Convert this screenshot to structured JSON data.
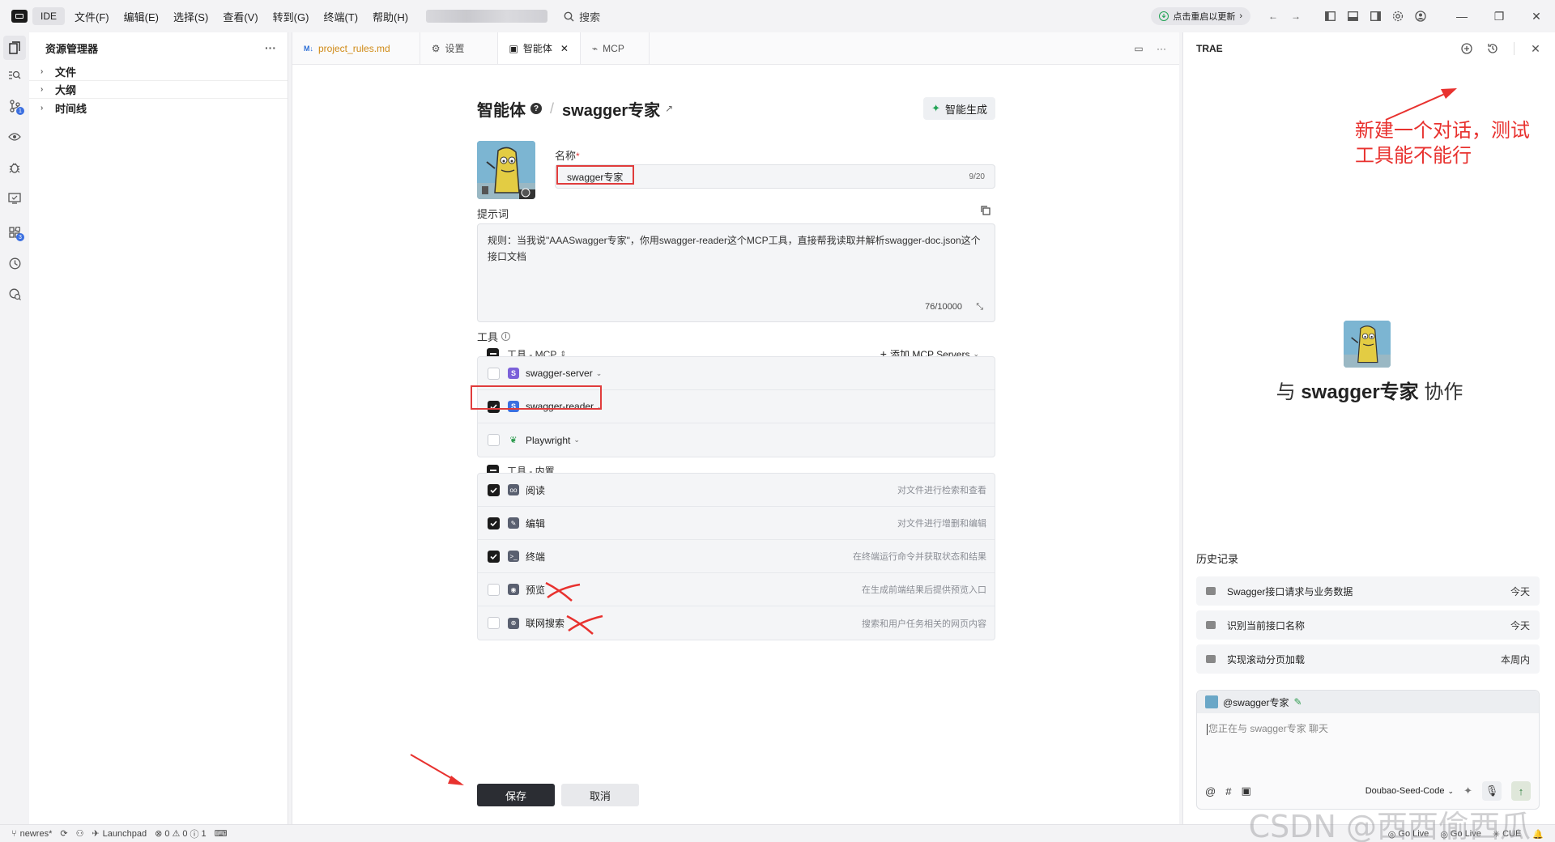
{
  "titlebar": {
    "ide_label": "IDE",
    "menu": [
      "文件(F)",
      "编辑(E)",
      "选择(S)",
      "查看(V)",
      "转到(G)",
      "终端(T)",
      "帮助(H)"
    ],
    "search_label": "搜索",
    "update_label": "点击重启以更新"
  },
  "explorer": {
    "title": "资源管理器",
    "items": [
      "文件",
      "大纲",
      "时间线"
    ]
  },
  "tabs": [
    {
      "label": "project_rules.md",
      "icon": "markdown-icon"
    },
    {
      "label": "设置",
      "icon": "gear-icon"
    },
    {
      "label": "智能体",
      "icon": "agent-icon"
    },
    {
      "label": "MCP",
      "icon": "plug-icon"
    }
  ],
  "agent": {
    "section_title": "智能体",
    "agent_name": "swagger专家",
    "generate_label": "智能生成",
    "name_label": "名称",
    "name_required": "*",
    "name_value": "swagger专家",
    "name_count": "9/20",
    "prompt_label": "提示词",
    "prompt_text": "规则：当我说\"AAASwagger专家\"，你用swagger-reader这个MCP工具，直接帮我读取并解析swagger-doc.json这个接口文档",
    "prompt_count": "76/10000",
    "tools_label": "工具",
    "mcp_group_label": "工具 - MCP",
    "add_mcp_label": "添加 MCP Servers",
    "mcp_tools": [
      {
        "name": "swagger-server",
        "checked": false,
        "icon_color": "#7b61d9"
      },
      {
        "name": "swagger-reader",
        "checked": true,
        "icon_color": "#3b6fe0"
      },
      {
        "name": "Playwright",
        "checked": false,
        "icon_color": "#2e9b4f"
      }
    ],
    "builtin_group_label": "工具 - 内置",
    "builtin_tools": [
      {
        "name": "阅读",
        "desc": "对文件进行检索和查看",
        "checked": true
      },
      {
        "name": "编辑",
        "desc": "对文件进行增删和编辑",
        "checked": true
      },
      {
        "name": "终端",
        "desc": "在终端运行命令并获取状态和结果",
        "checked": true
      },
      {
        "name": "预览",
        "desc": "在生成前端结果后提供预览入口",
        "checked": false
      },
      {
        "name": "联网搜索",
        "desc": "搜索和用户任务相关的网页内容",
        "checked": false
      }
    ],
    "save_label": "保存",
    "cancel_label": "取消"
  },
  "panel": {
    "title": "TRAE",
    "annotation_line1": "新建一个对话，测试",
    "annotation_line2": "工具能不能行",
    "collab_prefix": "与",
    "collab_name": "swagger专家",
    "collab_suffix": "协作",
    "history_title": "历史记录",
    "history": [
      {
        "title": "Swagger接口请求与业务数据",
        "when": "今天"
      },
      {
        "title": "识别当前接口名称",
        "when": "今天"
      },
      {
        "title": "实现滚动分页加载",
        "when": "本周内"
      }
    ],
    "mention": "@swagger专家",
    "chat_placeholder": "您正在与 swagger专家 聊天",
    "model": "Doubao-Seed-Code"
  },
  "statusbar": {
    "branch": "newres*",
    "launchpad": "Launchpad",
    "errors": "0",
    "warnings": "0",
    "infos": "1",
    "golive1": "Go Live",
    "golive2": "Go Live",
    "cue": "CUE"
  },
  "watermark": "CSDN @西西偷西瓜",
  "colors": {
    "accent": "#3b6fe0",
    "annotation": "#e8322f",
    "dark_button": "#2b2d33"
  }
}
